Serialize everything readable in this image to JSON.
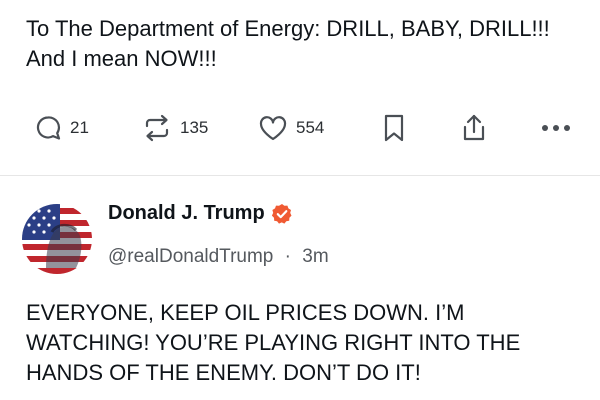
{
  "previous_post": {
    "text": "To The Department of Energy: DRILL, BABY, DRILL!!! And I mean NOW!!!"
  },
  "actions": {
    "reply_count": "21",
    "repost_count": "135",
    "like_count": "554"
  },
  "post": {
    "author_name": "Donald J. Trump",
    "handle": "@realDonaldTrump",
    "separator": "·",
    "time": "3m",
    "verified": true,
    "text": "EVERYONE, KEEP OIL PRICES DOWN. I’M WATCHING! YOU’RE PLAYING RIGHT INTO THE HANDS OF THE ENEMY. DON’T DO IT!"
  },
  "icons": {
    "reply": "speech-bubble-icon",
    "repost": "repost-arrows-icon",
    "like": "heart-icon",
    "bookmark": "bookmark-icon",
    "share": "share-icon",
    "more": "ellipsis-icon",
    "verified": "verified-badge-icon"
  },
  "colors": {
    "verified_badge": "#f05a33",
    "text": "#0f1419",
    "muted": "#55595e",
    "icon": "#4a4f55"
  }
}
